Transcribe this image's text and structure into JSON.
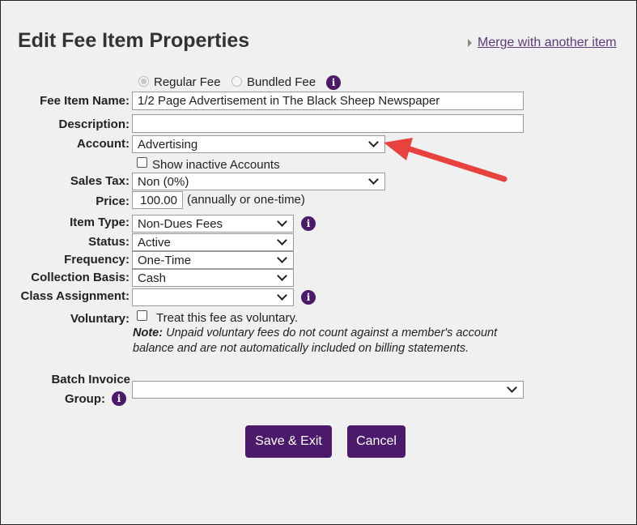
{
  "page": {
    "title": "Edit Fee Item Properties",
    "merge_link": "Merge with another item"
  },
  "fee_type": {
    "regular_label": "Regular Fee",
    "bundled_label": "Bundled Fee",
    "selected": "Regular Fee"
  },
  "fields": {
    "name_label": "Fee Item Name:",
    "name_value": "1/2 Page Advertisement in The Black Sheep Newspaper",
    "description_label": "Description:",
    "description_value": "",
    "account_label": "Account:",
    "account_value": "Advertising",
    "show_inactive_label": "Show inactive Accounts",
    "sales_tax_label": "Sales Tax:",
    "sales_tax_value": "Non (0%)",
    "price_label": "Price:",
    "price_value": "100.00",
    "price_note": "(annually or one-time)",
    "item_type_label": "Item Type:",
    "item_type_value": "Non-Dues Fees",
    "status_label": "Status:",
    "status_value": "Active",
    "frequency_label": "Frequency:",
    "frequency_value": "One-Time",
    "collection_label": "Collection Basis:",
    "collection_value": "Cash",
    "class_label": "Class Assignment:",
    "class_value": "",
    "voluntary_label": "Voluntary:",
    "voluntary_checkbox_label": "Treat this fee as voluntary.",
    "note_prefix": "Note:",
    "note_text": " Unpaid voluntary fees do not count against a member's account balance and are not automatically included on billing statements.",
    "batch_label_1": "Batch Invoice",
    "batch_label_2": "Group:",
    "batch_value": ""
  },
  "buttons": {
    "save": "Save & Exit",
    "cancel": "Cancel"
  },
  "colors": {
    "accent": "#4b1a6b",
    "link": "#5a3d78",
    "arrow": "#e8423f"
  },
  "icons": [
    "info-icon",
    "chevron-down-icon",
    "red-arrow-annotation"
  ]
}
